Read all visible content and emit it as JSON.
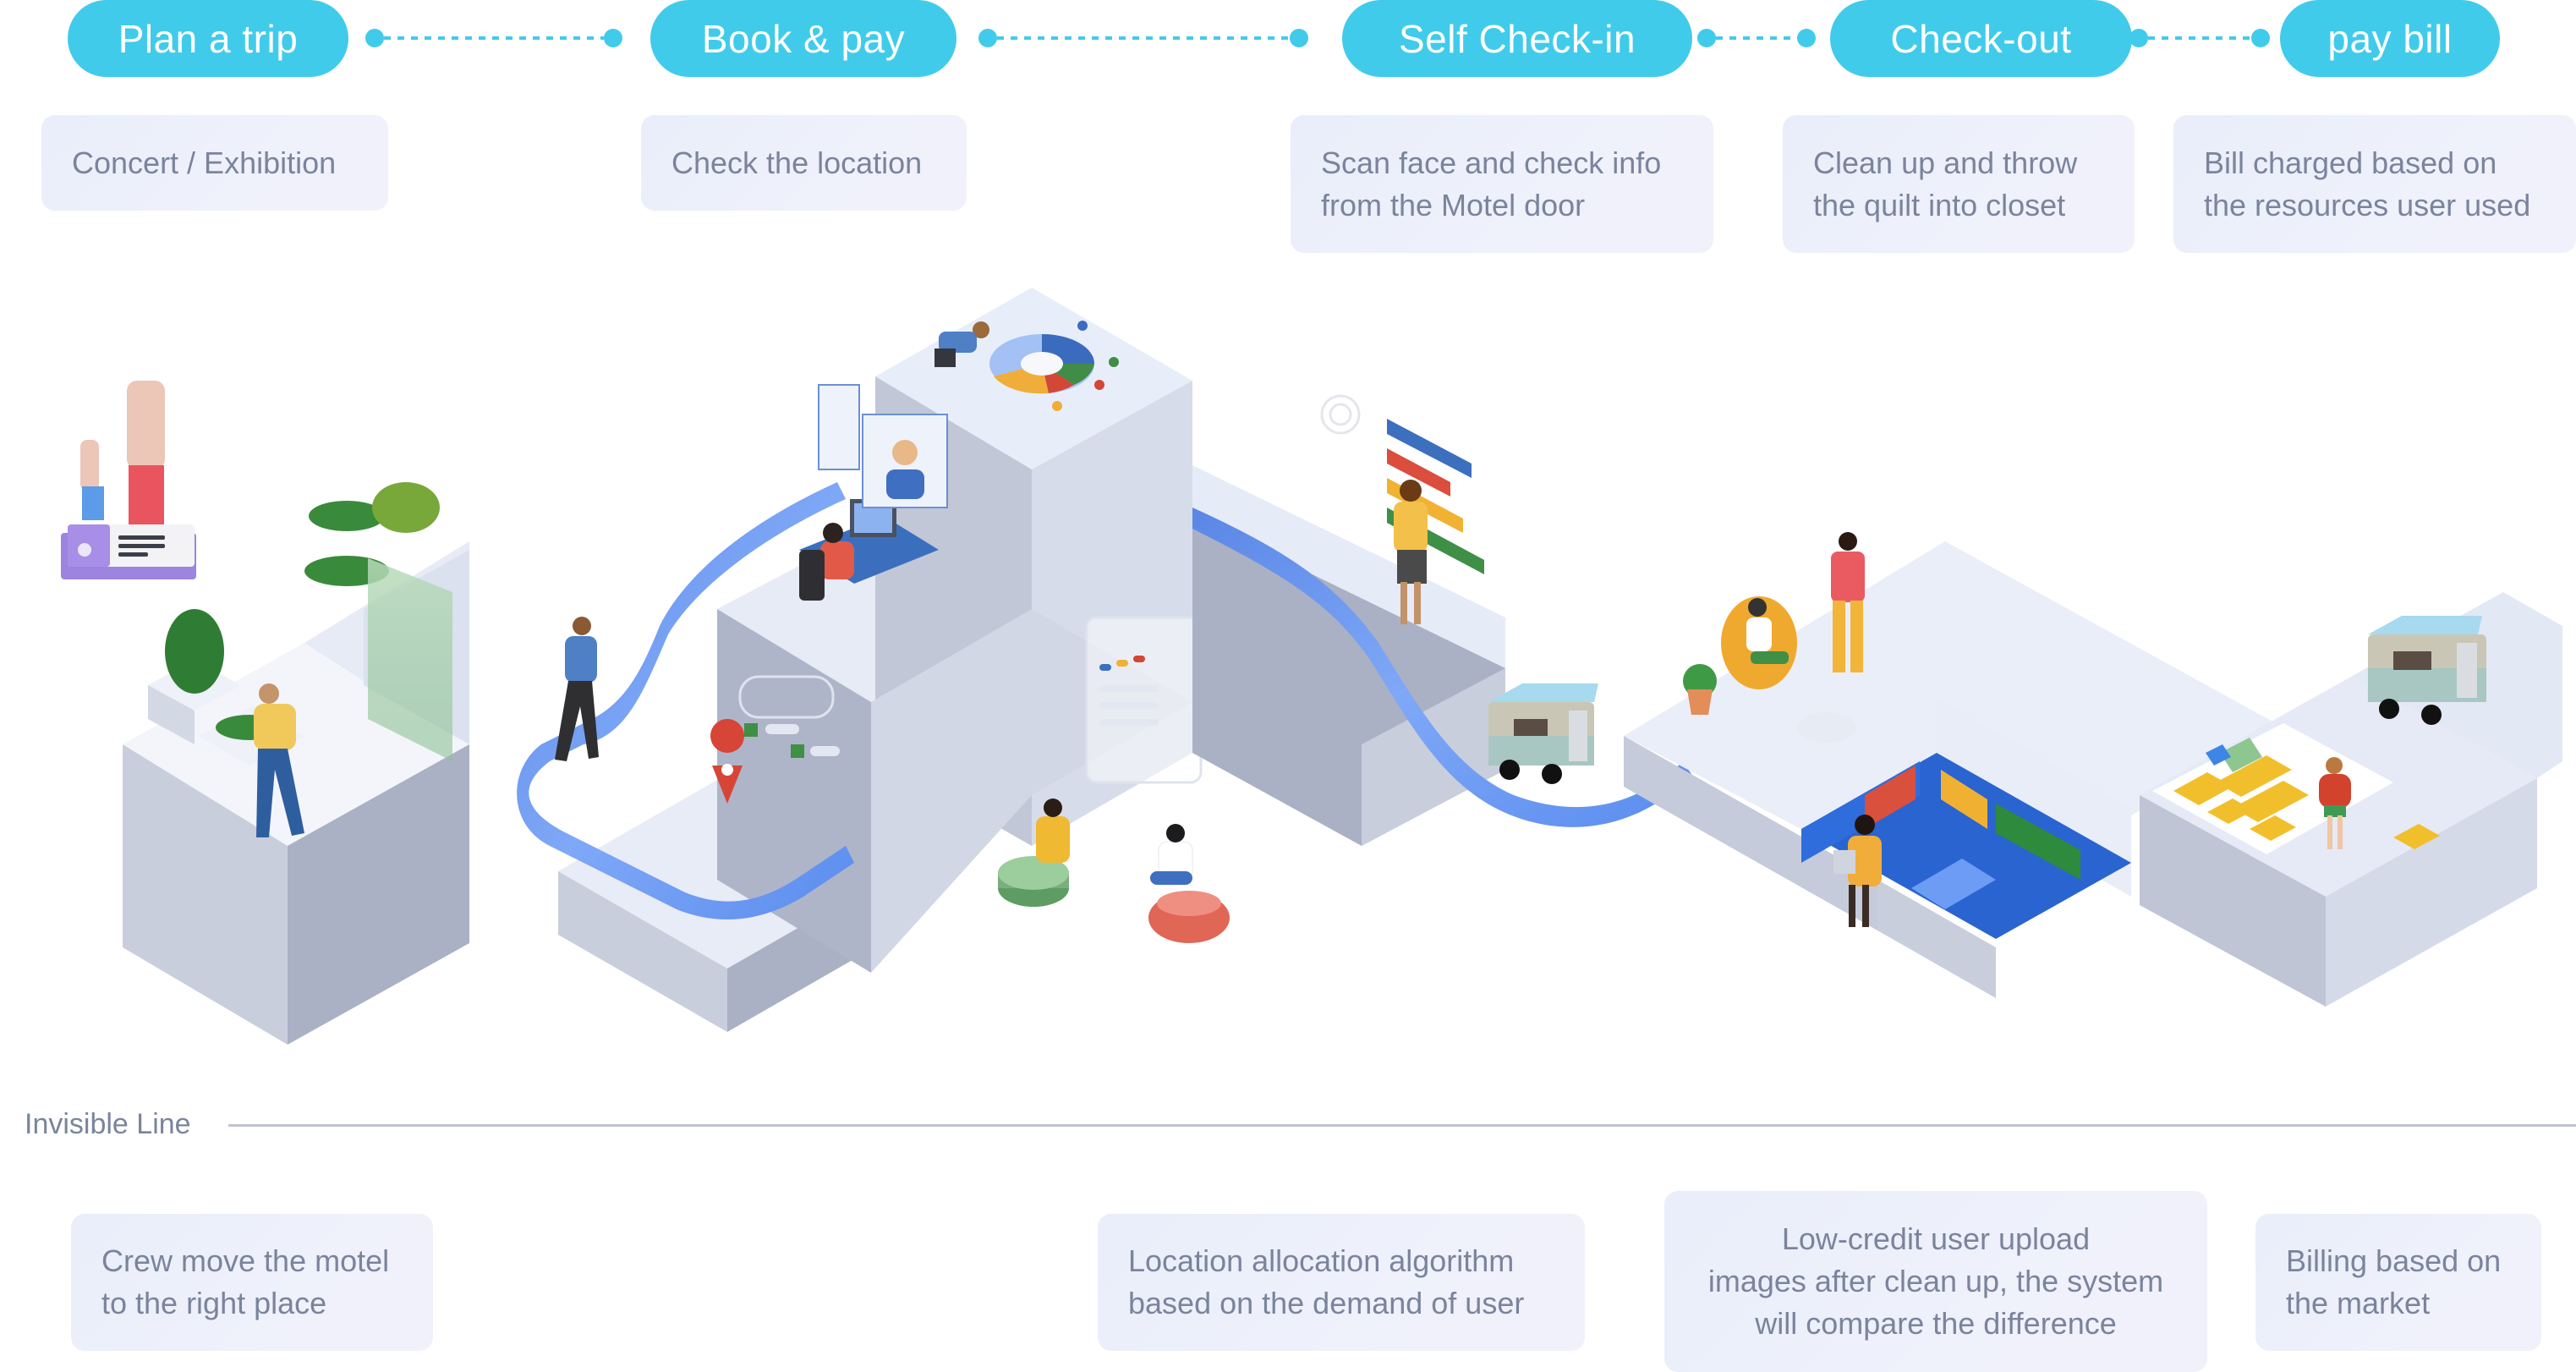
{
  "journey": {
    "stages": [
      {
        "label": "Plan a trip"
      },
      {
        "label": "Book & pay"
      },
      {
        "label": "Self Check-in"
      },
      {
        "label": "Check-out"
      },
      {
        "label": "pay bill"
      }
    ],
    "user_actions": [
      {
        "text": "Concert / Exhibition"
      },
      {
        "text": "Check the location"
      },
      {
        "text": "Scan face and check info\nfrom the Motel door"
      },
      {
        "text": "Clean up and throw\nthe quilt into closet"
      },
      {
        "text": "Bill charged based on\nthe resources user used"
      }
    ],
    "divider": {
      "label": "Invisible Line"
    },
    "backstage_actions": [
      {
        "text": "Crew move the motel\nto the right place"
      },
      {
        "text": "Location allocation algorithm\n based on the demand of user"
      },
      {
        "text": "Low-credit user upload\nimages after clean up, the system\nwill compare the difference"
      },
      {
        "text": "Billing based on\nthe market"
      }
    ]
  },
  "illustration": {
    "scenes": [
      {
        "name": "concert-ticket-scene",
        "icons": [
          "raised-hands-icon",
          "music-ticket-icon"
        ]
      },
      {
        "name": "booking-scene",
        "icons": [
          "location-pin-icon",
          "donut-chart-icon",
          "video-call-icon",
          "search-form-icon"
        ]
      },
      {
        "name": "check-in-scene",
        "icons": [
          "face-scan-icon",
          "bar-chart-icon",
          "motel-pod-icon"
        ]
      },
      {
        "name": "lounge-scene",
        "icons": [
          "sofa-icon",
          "plant-icon"
        ]
      },
      {
        "name": "billing-scene",
        "icons": [
          "gold-blocks-icon",
          "cv-document-icon",
          "motel-pod-icon"
        ]
      }
    ],
    "colors": {
      "accent": "#41cbeb",
      "ribbon": "#5b8def",
      "block_top": "#eef2fb",
      "block_left": "#c9cedd",
      "block_right": "#aeb4c6",
      "google_blue": "#3d6fbf",
      "google_red": "#db4d3d",
      "google_yellow": "#f1b133",
      "google_green": "#3f8f47"
    }
  }
}
